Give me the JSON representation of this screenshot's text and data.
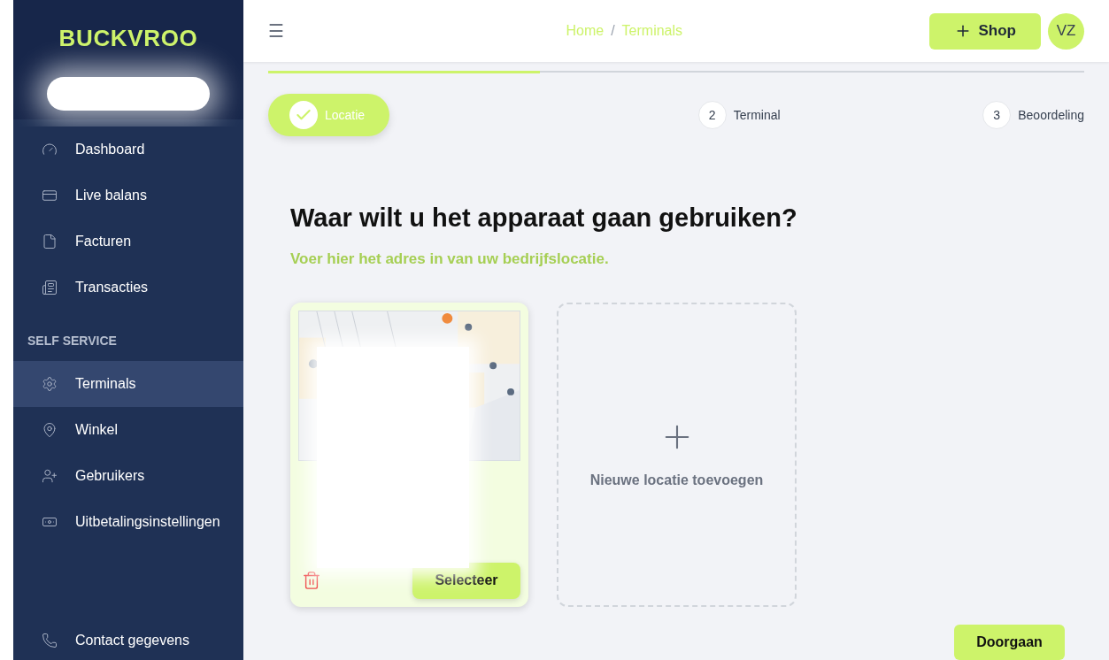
{
  "sidebar": {
    "logo": "BUCKVROO",
    "items": [
      {
        "label": "Dashboard",
        "selected": false
      },
      {
        "label": "Live balans",
        "selected": false
      },
      {
        "label": "Facturen",
        "selected": false
      },
      {
        "label": "Transacties",
        "selected": false
      }
    ],
    "section": "SELF SERVICE",
    "section_items": [
      {
        "label": "Terminals",
        "selected": true
      },
      {
        "label": "Winkel",
        "selected": false
      },
      {
        "label": "Gebruikers",
        "selected": false
      },
      {
        "label": "Uitbetalingsinstellingen",
        "selected": false
      }
    ],
    "footer_item": {
      "label": "Contact gegevens"
    }
  },
  "header": {
    "menu_icon": "☰",
    "breadcrumb": [
      "Home",
      "Terminals"
    ],
    "separator": "/",
    "shop_button": "Shop",
    "avatar": "VZ"
  },
  "progress": {
    "level": 0.333
  },
  "steps": [
    {
      "label": "Locatie",
      "done": true
    },
    {
      "number": "2",
      "label": "Terminal",
      "done": false
    },
    {
      "number": "3",
      "label": "Beoordeling",
      "done": false
    }
  ],
  "title": "Waar wilt u het apparaat gaan gebruiken?",
  "subtitle": "Voer hier het adres in van uw bedrijfslocatie.",
  "location_card": {
    "kind": "picture",
    "select_button": "Selecteer"
  },
  "add_card": {
    "label": "Nieuwe locatie toevoegen"
  },
  "continue_button": "Doorgaan"
}
